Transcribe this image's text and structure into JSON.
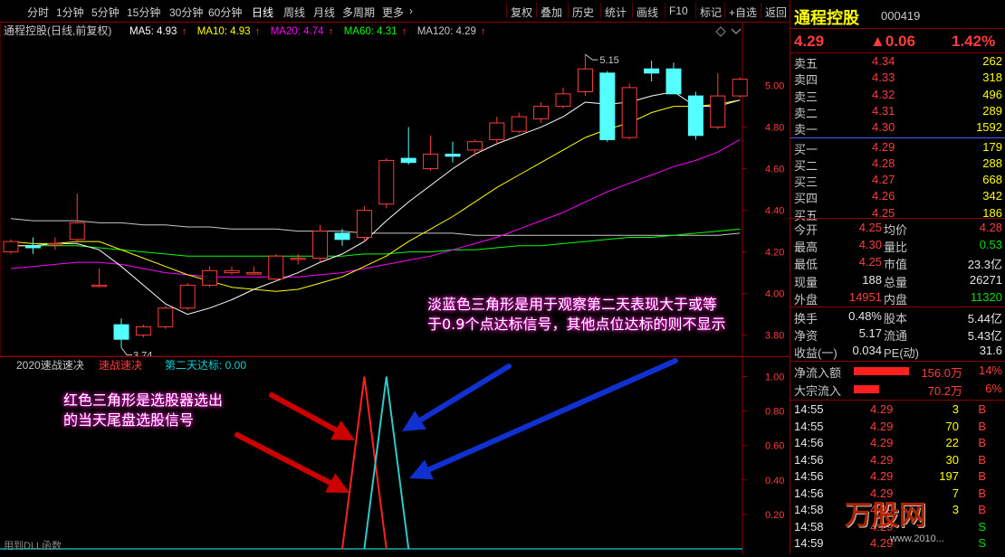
{
  "toolbar": {
    "periods": [
      "分时",
      "1分钟",
      "5分钟",
      "15分钟",
      "30分钟",
      "60分钟",
      "日线",
      "周线",
      "月线",
      "多周期",
      "更多"
    ],
    "active_period": "日线",
    "more_chevron": "›",
    "actions": [
      "复权",
      "叠加",
      "历史",
      "统计",
      "画线",
      "F10",
      "标记",
      "+自选",
      "返回"
    ]
  },
  "main_chart": {
    "title": "通程控股(日线,前复权)",
    "ma_legend": [
      {
        "label": "MA5: 4.93",
        "color": "#ffffff"
      },
      {
        "label": "MA10: 4.93",
        "color": "#ffff00"
      },
      {
        "label": "MA20: 4.74",
        "color": "#ff00ff"
      },
      {
        "label": "MA60: 4.31",
        "color": "#00ff00"
      },
      {
        "label": "MA120: 4.29",
        "color": "#c8c8c8"
      }
    ],
    "up_arrow": "↑",
    "high_label": "5.15",
    "low_label": "3.74",
    "y_ticks": [
      "5.00",
      "4.80",
      "4.60",
      "4.40",
      "4.20",
      "4.00",
      "3.80"
    ]
  },
  "sub_chart": {
    "title": "2020速战速决",
    "line1_label": "速战速决",
    "line2_label": "第二天达标: 0.00",
    "y_ticks": [
      "1.00",
      "0.80",
      "0.60",
      "0.40",
      "0.20"
    ],
    "footer": "用到DLL函数"
  },
  "annotations": {
    "blue_note_line1": "淡蓝色三角形是用于观察第二天表现大于或等",
    "blue_note_line2": "于0.9个点达标信号，其他点位达标的则不显示",
    "red_note_line1": "红色三角形是选股器选出",
    "red_note_line2": "的当天尾盘选股信号"
  },
  "quote": {
    "name": "通程控股",
    "code": "000419",
    "price": "4.29",
    "change": "▲0.06",
    "change_pct": "1.42%",
    "asks": [
      {
        "label": "卖五",
        "price": "4.34",
        "vol": "262"
      },
      {
        "label": "卖四",
        "price": "4.33",
        "vol": "318"
      },
      {
        "label": "卖三",
        "price": "4.32",
        "vol": "496"
      },
      {
        "label": "卖二",
        "price": "4.31",
        "vol": "289"
      },
      {
        "label": "卖一",
        "price": "4.30",
        "vol": "1592"
      }
    ],
    "bids": [
      {
        "label": "买一",
        "price": "4.29",
        "vol": "179"
      },
      {
        "label": "买二",
        "price": "4.28",
        "vol": "288"
      },
      {
        "label": "买三",
        "price": "4.27",
        "vol": "668"
      },
      {
        "label": "买四",
        "price": "4.26",
        "vol": "342"
      },
      {
        "label": "买五",
        "price": "4.25",
        "vol": "186"
      }
    ],
    "stats": [
      {
        "l1": "今开",
        "v1": "4.25",
        "c1": "red",
        "l2": "均价",
        "v2": "4.28",
        "c2": "red"
      },
      {
        "l1": "最高",
        "v1": "4.30",
        "c1": "red",
        "l2": "量比",
        "v2": "0.53",
        "c2": "grn"
      },
      {
        "l1": "最低",
        "v1": "4.25",
        "c1": "red",
        "l2": "市值",
        "v2": "23.3亿",
        "c2": "wht"
      },
      {
        "l1": "现量",
        "v1": "188",
        "c1": "wht",
        "l2": "总量",
        "v2": "26271",
        "c2": "wht"
      },
      {
        "l1": "外盘",
        "v1": "14951",
        "c1": "red",
        "l2": "内盘",
        "v2": "11320",
        "c2": "grn"
      }
    ],
    "stats2": [
      {
        "l1": "换手",
        "v1": "0.48%",
        "l2": "股本",
        "v2": "5.44亿"
      },
      {
        "l1": "净资",
        "v1": "5.17",
        "l2": "流通",
        "v2": "5.43亿"
      },
      {
        "l1": "收益(一)",
        "v1": "0.034",
        "l2": "PE(动)",
        "v2": "31.6"
      }
    ],
    "flows": [
      {
        "label": "净流入额",
        "value": "156.0万",
        "pct": "14%",
        "bar": 0.55
      },
      {
        "label": "大宗流入",
        "value": "70.2万",
        "pct": "6%",
        "bar": 0.25
      }
    ],
    "ticks": [
      {
        "time": "14:55",
        "price": "4.29",
        "vol": "3",
        "side": "B"
      },
      {
        "time": "14:55",
        "price": "4.29",
        "vol": "70",
        "side": "B"
      },
      {
        "time": "14:56",
        "price": "4.29",
        "vol": "22",
        "side": "B"
      },
      {
        "time": "14:56",
        "price": "4.29",
        "vol": "30",
        "side": "B"
      },
      {
        "time": "14:56",
        "price": "4.29",
        "vol": "197",
        "side": "B"
      },
      {
        "time": "14:56",
        "price": "4.29",
        "vol": "7",
        "side": "B"
      },
      {
        "time": "14:58",
        "price": "4.29",
        "vol": "3",
        "side": "B"
      },
      {
        "time": "14:58",
        "price": "4.29",
        "vol": "",
        "side": "S"
      },
      {
        "time": "14:59",
        "price": "4.29",
        "vol": "",
        "side": "S"
      }
    ],
    "watermark": "万股网",
    "watermark_url": "www.2010..."
  },
  "chart_data": {
    "type": "candlestick",
    "candles": [
      {
        "o": 4.2,
        "h": 4.26,
        "l": 4.19,
        "c": 4.25
      },
      {
        "o": 4.23,
        "h": 4.27,
        "l": 4.19,
        "c": 4.22
      },
      {
        "o": 4.24,
        "h": 4.27,
        "l": 4.21,
        "c": 4.24
      },
      {
        "o": 4.26,
        "h": 4.48,
        "l": 4.23,
        "c": 4.34
      },
      {
        "o": 4.04,
        "h": 4.12,
        "l": 4.03,
        "c": 4.04
      },
      {
        "o": 3.85,
        "h": 3.88,
        "l": 3.74,
        "c": 3.78
      },
      {
        "o": 3.8,
        "h": 3.85,
        "l": 3.79,
        "c": 3.84
      },
      {
        "o": 3.84,
        "h": 3.94,
        "l": 3.83,
        "c": 3.93
      },
      {
        "o": 3.93,
        "h": 4.05,
        "l": 3.92,
        "c": 4.04
      },
      {
        "o": 4.04,
        "h": 4.13,
        "l": 4.03,
        "c": 4.11
      },
      {
        "o": 4.1,
        "h": 4.13,
        "l": 4.09,
        "c": 4.11
      },
      {
        "o": 4.1,
        "h": 4.13,
        "l": 4.09,
        "c": 4.1
      },
      {
        "o": 4.07,
        "h": 4.19,
        "l": 4.06,
        "c": 4.18
      },
      {
        "o": 4.17,
        "h": 4.19,
        "l": 4.14,
        "c": 4.17
      },
      {
        "o": 4.17,
        "h": 4.33,
        "l": 4.15,
        "c": 4.3
      },
      {
        "o": 4.29,
        "h": 4.31,
        "l": 4.23,
        "c": 4.26
      },
      {
        "o": 4.27,
        "h": 4.42,
        "l": 4.25,
        "c": 4.4
      },
      {
        "o": 4.43,
        "h": 4.65,
        "l": 4.41,
        "c": 4.64
      },
      {
        "o": 4.65,
        "h": 4.8,
        "l": 4.62,
        "c": 4.63
      },
      {
        "o": 4.6,
        "h": 4.76,
        "l": 4.59,
        "c": 4.67
      },
      {
        "o": 4.67,
        "h": 4.73,
        "l": 4.63,
        "c": 4.66
      },
      {
        "o": 4.69,
        "h": 4.74,
        "l": 4.66,
        "c": 4.73
      },
      {
        "o": 4.74,
        "h": 4.85,
        "l": 4.72,
        "c": 4.82
      },
      {
        "o": 4.78,
        "h": 4.87,
        "l": 4.77,
        "c": 4.85
      },
      {
        "o": 4.84,
        "h": 4.92,
        "l": 4.82,
        "c": 4.9
      },
      {
        "o": 4.9,
        "h": 4.99,
        "l": 4.89,
        "c": 4.96
      },
      {
        "o": 4.97,
        "h": 5.15,
        "l": 4.95,
        "c": 5.08
      },
      {
        "o": 5.06,
        "h": 5.07,
        "l": 4.73,
        "c": 4.74
      },
      {
        "o": 4.75,
        "h": 5.01,
        "l": 4.74,
        "c": 4.99
      },
      {
        "o": 5.08,
        "h": 5.12,
        "l": 5.02,
        "c": 5.06
      },
      {
        "o": 5.08,
        "h": 5.11,
        "l": 4.96,
        "c": 4.96
      },
      {
        "o": 4.95,
        "h": 4.97,
        "l": 4.74,
        "c": 4.76
      },
      {
        "o": 4.8,
        "h": 5.06,
        "l": 4.79,
        "c": 4.95
      },
      {
        "o": 4.95,
        "h": 5.04,
        "l": 4.94,
        "c": 5.03
      }
    ],
    "ma5": [
      4.23,
      4.23,
      4.24,
      4.24,
      4.21,
      4.13,
      4.04,
      3.95,
      3.9,
      3.93,
      3.97,
      4.02,
      4.06,
      4.1,
      4.15,
      4.19,
      4.25,
      4.35,
      4.44,
      4.52,
      4.6,
      4.67,
      4.72,
      4.76,
      4.8,
      4.85,
      4.92,
      4.91,
      4.92,
      4.95,
      4.97,
      4.9,
      4.9,
      4.93
    ],
    "ma10": [
      4.25,
      4.24,
      4.24,
      4.25,
      4.25,
      4.21,
      4.17,
      4.13,
      4.09,
      4.06,
      4.03,
      4.02,
      4.01,
      4.02,
      4.05,
      4.08,
      4.13,
      4.18,
      4.25,
      4.31,
      4.37,
      4.44,
      4.51,
      4.57,
      4.63,
      4.69,
      4.75,
      4.79,
      4.82,
      4.87,
      4.9,
      4.9,
      4.91,
      4.93
    ],
    "ma20": [
      4.12,
      4.13,
      4.14,
      4.15,
      4.15,
      4.14,
      4.12,
      4.1,
      4.09,
      4.08,
      4.08,
      4.08,
      4.08,
      4.08,
      4.09,
      4.1,
      4.12,
      4.14,
      4.16,
      4.18,
      4.21,
      4.24,
      4.27,
      4.31,
      4.35,
      4.39,
      4.44,
      4.49,
      4.53,
      4.57,
      4.61,
      4.64,
      4.68,
      4.74
    ],
    "ma60": [
      4.23,
      4.23,
      4.23,
      4.23,
      4.22,
      4.21,
      4.2,
      4.19,
      4.18,
      4.18,
      4.18,
      4.18,
      4.18,
      4.18,
      4.18,
      4.18,
      4.19,
      4.19,
      4.2,
      4.2,
      4.21,
      4.21,
      4.22,
      4.23,
      4.23,
      4.24,
      4.25,
      4.26,
      4.27,
      4.27,
      4.28,
      4.29,
      4.3,
      4.31
    ],
    "ma120": [
      4.36,
      4.35,
      4.35,
      4.35,
      4.34,
      4.34,
      4.33,
      4.33,
      4.32,
      4.32,
      4.31,
      4.31,
      4.31,
      4.3,
      4.3,
      4.3,
      4.29,
      4.29,
      4.29,
      4.29,
      4.29,
      4.28,
      4.28,
      4.28,
      4.28,
      4.28,
      4.28,
      4.28,
      4.28,
      4.28,
      4.28,
      4.28,
      4.28,
      4.29
    ],
    "y_range": [
      3.72,
      5.22
    ],
    "signal_red": {
      "start_index": 15,
      "peak_index": 16,
      "end_index": 17,
      "peak": 1.0
    },
    "signal_cyan": {
      "start_index": 16,
      "peak_index": 17,
      "end_index": 18,
      "peak": 1.0
    },
    "sub_y_range": [
      0,
      1.05
    ]
  }
}
